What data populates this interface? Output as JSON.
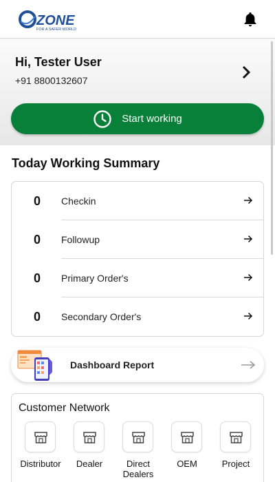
{
  "header": {
    "logo_text": "ZONE",
    "logo_tagline": "FOR A SAFER WORLD",
    "notification_icon": "bell-icon"
  },
  "user": {
    "greeting": "Hi, Tester User",
    "phone": "+91 8800132607"
  },
  "start_button": {
    "label": "Start working",
    "icon": "clock-icon",
    "color": "#08803a"
  },
  "summary": {
    "title": "Today Working Summary",
    "items": [
      {
        "count": "0",
        "label": "Checkin"
      },
      {
        "count": "0",
        "label": "Followup"
      },
      {
        "count": "0",
        "label": "Primary Order's"
      },
      {
        "count": "0",
        "label": "Secondary Order's"
      }
    ]
  },
  "dashboard": {
    "label": "Dashboard Report"
  },
  "network": {
    "title": "Customer Network",
    "items": [
      {
        "label": "Distributor",
        "icon": "store-icon"
      },
      {
        "label": "Dealer",
        "icon": "store-icon"
      },
      {
        "label": "Direct Dealers",
        "icon": "store-icon"
      },
      {
        "label": "OEM",
        "icon": "store-icon"
      },
      {
        "label": "Project",
        "icon": "store-icon"
      }
    ]
  },
  "colors": {
    "brand_blue": "#1f4e96",
    "accent_green": "#08803a"
  }
}
